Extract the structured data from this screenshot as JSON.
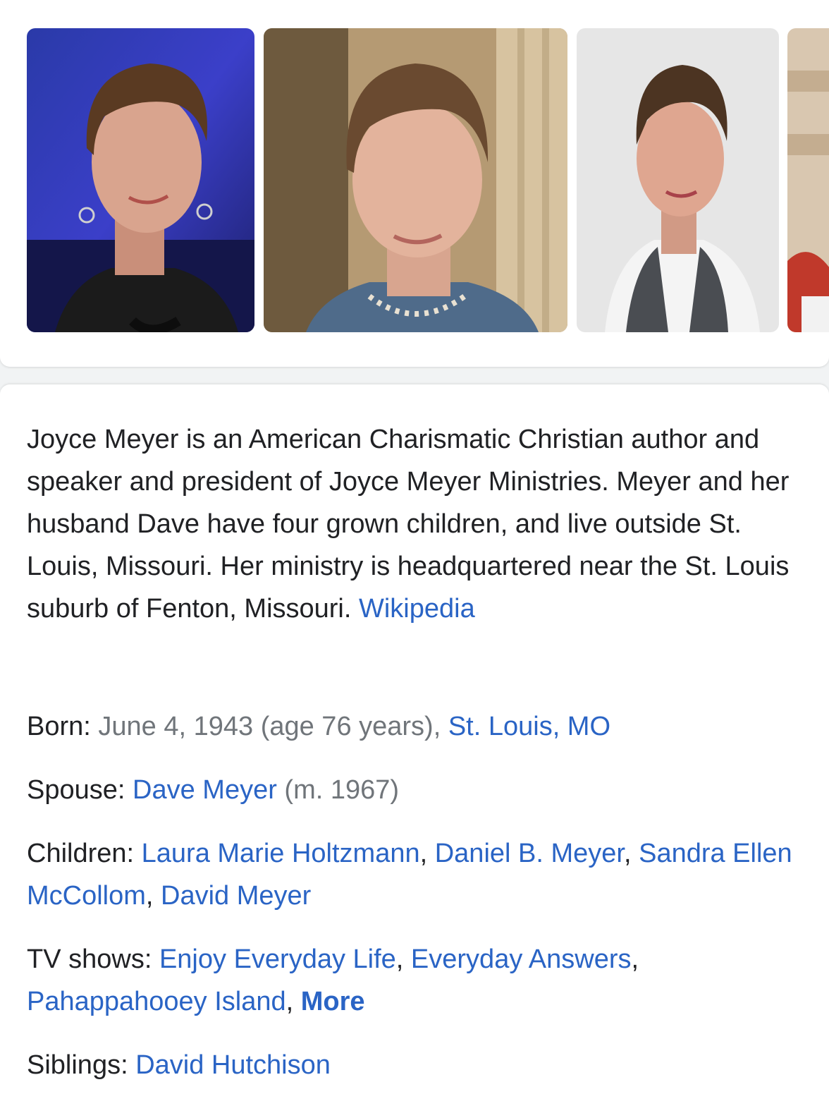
{
  "images": [
    {
      "alt": "Joyce Meyer photo 1"
    },
    {
      "alt": "Joyce Meyer photo 2"
    },
    {
      "alt": "Joyce Meyer photo 3"
    },
    {
      "alt": "Joyce Meyer photo 4"
    }
  ],
  "description": {
    "text": "Joyce Meyer is an American Charismatic Christian author and speaker and president of Joyce Meyer Ministries. Meyer and her husband Dave have four grown children, and live outside St. Louis, Missouri. Her ministry is headquartered near the St. Louis suburb of Fenton, Missouri.",
    "source_link": "Wikipedia"
  },
  "facts": {
    "born": {
      "label": "Born:",
      "value": "June 4, 1943 (age 76 years),",
      "place_link": "St. Louis, MO"
    },
    "spouse": {
      "label": "Spouse:",
      "link": "Dave Meyer",
      "note": "(m. 1967)"
    },
    "children": {
      "label": "Children:",
      "links": [
        "Laura Marie Holtzmann",
        "Daniel B. Meyer",
        "Sandra Ellen McCollom",
        "David Meyer"
      ]
    },
    "tv_shows": {
      "label": "TV shows:",
      "links": [
        "Enjoy Everyday Life",
        "Everyday Answers",
        "Pahappahooey Island"
      ],
      "more": "More"
    },
    "siblings": {
      "label": "Siblings:",
      "link": "David Hutchison"
    }
  },
  "colors": {
    "link": "#2a64c5",
    "text": "#202124",
    "muted": "#70757a"
  }
}
